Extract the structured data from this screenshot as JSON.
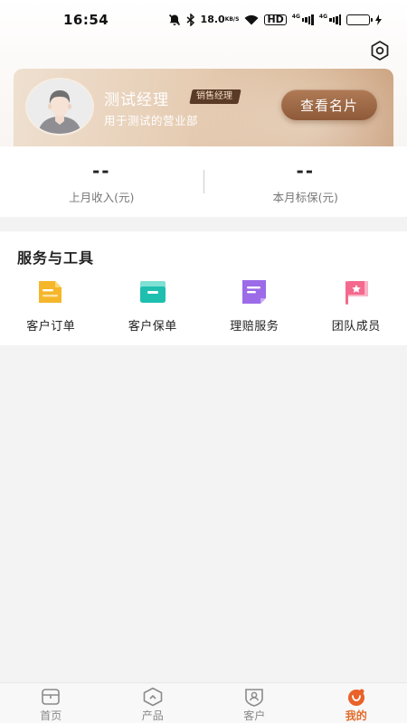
{
  "status_bar": {
    "time": "16:54",
    "net_speed_value": "18.0",
    "net_speed_unit": "KB/S",
    "hd_label": "HD",
    "sig1_label": "4G",
    "sig2_label": "4G"
  },
  "profile": {
    "name": "测试经理",
    "role": "销售经理",
    "department": "用于测试的营业部",
    "card_button": "查看名片"
  },
  "stats": [
    {
      "value": "--",
      "label": "上月收入(元)"
    },
    {
      "value": "--",
      "label": "本月标保(元)"
    }
  ],
  "services": {
    "title": "服务与工具",
    "tools": [
      {
        "label": "客户订单",
        "icon": "order-icon",
        "color": "#f5b62a"
      },
      {
        "label": "客户保单",
        "icon": "policy-icon",
        "color": "#1fbfb0"
      },
      {
        "label": "理赔服务",
        "icon": "claim-icon",
        "color": "#9b6be8"
      },
      {
        "label": "团队成员",
        "icon": "team-flag-icon",
        "color": "#f36a8e"
      }
    ]
  },
  "bottom_nav": {
    "items": [
      {
        "label": "首页",
        "icon": "home-icon",
        "active": false
      },
      {
        "label": "产品",
        "icon": "product-icon",
        "active": false
      },
      {
        "label": "客户",
        "icon": "customer-icon",
        "active": false
      },
      {
        "label": "我的",
        "icon": "mine-icon",
        "active": true
      }
    ],
    "active_color": "#e06a2a"
  },
  "colors": {
    "card_gradient_start": "#efe0d0",
    "card_gradient_end": "#caa07d",
    "card_button": "#9a6442",
    "page_background": "#f3f3f4"
  }
}
